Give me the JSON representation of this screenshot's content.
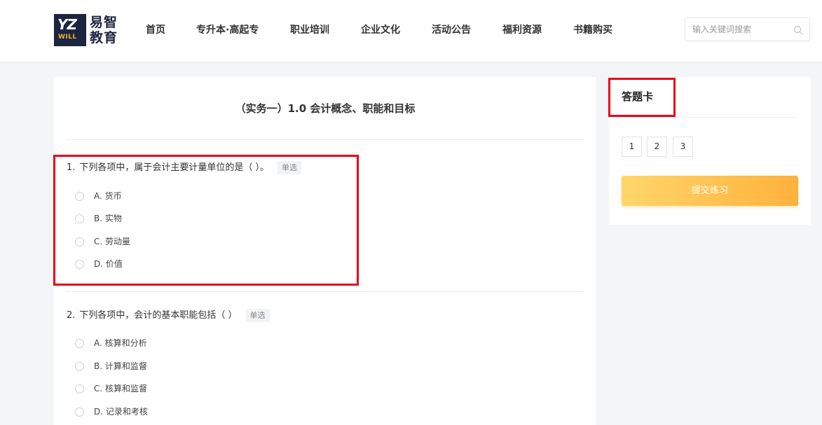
{
  "brand": {
    "mark_text": "YZ",
    "mark_subtext": "WILL",
    "name_line1": "易智",
    "name_line2": "教育",
    "mark_color": "#1d2540",
    "accent_color": "#f3b53b"
  },
  "nav": {
    "items": [
      {
        "label": "首页"
      },
      {
        "label": "专升本·高起专"
      },
      {
        "label": "职业培训"
      },
      {
        "label": "企业文化"
      },
      {
        "label": "活动公告"
      },
      {
        "label": "福利资源"
      },
      {
        "label": "书籍购买"
      }
    ]
  },
  "search": {
    "placeholder": "输入关键词搜索",
    "value": "",
    "icon": "search-icon"
  },
  "paper": {
    "title": "（实务一）1.0 会计概念、职能和目标"
  },
  "questions": [
    {
      "number": "1.",
      "text": "下列各项中，属于会计主要计量单位的是（  ）。",
      "tag": "单选",
      "options": [
        "A. 货币",
        "B. 实物",
        "C. 劳动量",
        "D. 价值"
      ]
    },
    {
      "number": "2.",
      "text": "下列各项中，会计的基本职能包括（  ）",
      "tag": "单选",
      "options": [
        "A. 核算和分析",
        "B. 计算和监督",
        "C. 核算和监督",
        "D. 记录和考核"
      ]
    }
  ],
  "answer_card": {
    "title": "答题卡",
    "numbers": [
      "1",
      "2",
      "3"
    ],
    "submit_label": "提交练习",
    "submit_colors": [
      "#ffd66b",
      "#ffb13b"
    ]
  },
  "highlight_color": "#e8001c"
}
